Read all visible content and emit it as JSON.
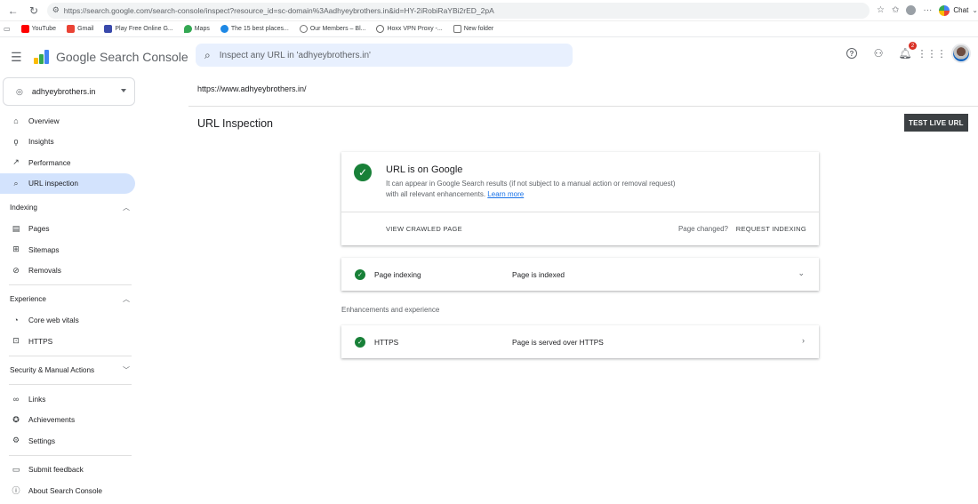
{
  "browser": {
    "url": "https://search.google.com/search-console/inspect?resource_id=sc-domain%3Aadhyeybrothers.in&id=HY-2iRobiRaYBi2rED_2pA",
    "chat_label": "Chat",
    "bookmarks": [
      {
        "label": "YouTube",
        "color": "#ff0000"
      },
      {
        "label": "Gmail",
        "color": "#ea4335"
      },
      {
        "label": "Play Free Online G...",
        "color": "#3949ab"
      },
      {
        "label": "Maps",
        "color": "#34a853"
      },
      {
        "label": "The 15 best places...",
        "color": "#1e88e5"
      },
      {
        "label": "Our Members – Bl...",
        "color": "#757575"
      },
      {
        "label": "Hoxx VPN Proxy -...",
        "color": "#616161"
      },
      {
        "label": "New folder",
        "color": "#9e9e9e"
      }
    ]
  },
  "app": {
    "title": "Google Search Console",
    "search_placeholder": "Inspect any URL in 'adhyeybrothers.in'",
    "notification_count": "2"
  },
  "sidebar": {
    "property": "adhyeybrothers.in",
    "top_items": [
      {
        "label": "Overview",
        "icon": "home-icon"
      },
      {
        "label": "Insights",
        "icon": "lightbulb-icon"
      },
      {
        "label": "Performance",
        "icon": "trending-icon"
      },
      {
        "label": "URL inspection",
        "icon": "search-icon"
      }
    ],
    "indexing_header": "Indexing",
    "indexing_items": [
      {
        "label": "Pages",
        "icon": "pages-icon"
      },
      {
        "label": "Sitemaps",
        "icon": "sitemap-icon"
      },
      {
        "label": "Removals",
        "icon": "removals-icon"
      }
    ],
    "experience_header": "Experience",
    "experience_items": [
      {
        "label": "Core web vitals",
        "icon": "gauge-icon"
      },
      {
        "label": "HTTPS",
        "icon": "lock-icon"
      }
    ],
    "security_header": "Security & Manual Actions",
    "bottom_items": [
      {
        "label": "Links",
        "icon": "link-icon"
      },
      {
        "label": "Achievements",
        "icon": "achievement-icon"
      },
      {
        "label": "Settings",
        "icon": "gear-icon"
      }
    ],
    "footer_items": [
      {
        "label": "Submit feedback",
        "icon": "feedback-icon"
      },
      {
        "label": "About Search Console",
        "icon": "info-icon"
      }
    ]
  },
  "main": {
    "inspected_url": "https://www.adhyeybrothers.in/",
    "page_title": "URL Inspection",
    "test_live_label": "TEST LIVE URL",
    "status_card": {
      "title": "URL is on Google",
      "description": "It can appear in Google Search results (if not subject to a manual action or removal request) with all relevant enhancements.",
      "learn_more": "Learn more",
      "view_crawled": "VIEW CRAWLED PAGE",
      "page_changed": "Page changed?",
      "request_indexing": "REQUEST INDEXING"
    },
    "indexing_row": {
      "label": "Page indexing",
      "value": "Page is indexed"
    },
    "enhancements_label": "Enhancements and experience",
    "https_row": {
      "label": "HTTPS",
      "value": "Page is served over HTTPS"
    }
  },
  "colors": {
    "accent": "#1a73e8",
    "active_nav": "#d3e3fd",
    "success": "#188038",
    "search_bg": "#e8f0fe",
    "button_dark": "#3c4043"
  }
}
